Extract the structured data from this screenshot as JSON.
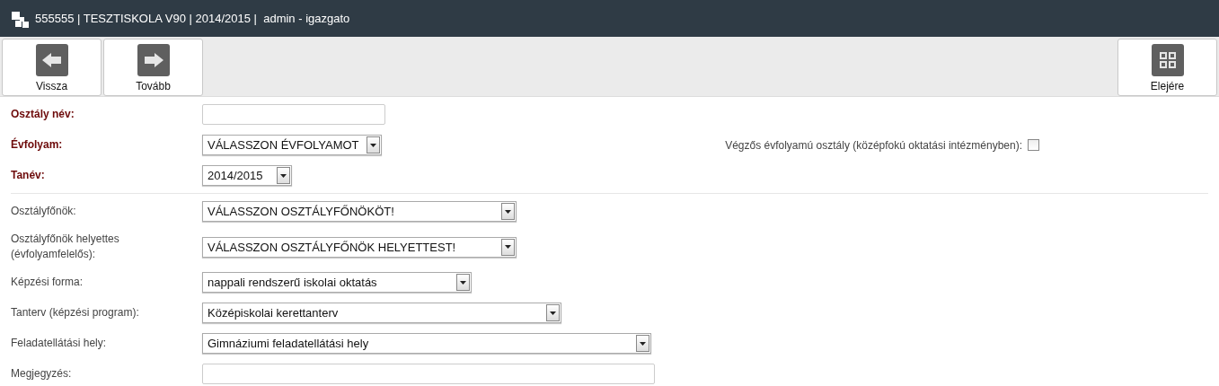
{
  "header": {
    "title": "555555 | TESZTISKOLA V90 | 2014/2015 |  admin - igazgato"
  },
  "toolbar": {
    "left": [
      {
        "kind": "back",
        "label": "Vissza"
      },
      {
        "kind": "forward",
        "label": "Tovább"
      }
    ],
    "right": [
      {
        "kind": "home",
        "label": "Elejére"
      }
    ]
  },
  "form": {
    "sections": [
      [
        {
          "label": "Osztály név:",
          "required": true,
          "kind": "text"
        },
        {
          "label": "Évfolyam:",
          "required": true,
          "kind": "select",
          "value": "VÁLASSZON ÉVFOLYAMOT",
          "extra": {
            "label": "Végzős évfolyamú osztály (középfokú oktatási intézményben):",
            "checked": false
          }
        },
        {
          "label": "Tanév:",
          "required": true,
          "kind": "select",
          "value": "2014/2015"
        }
      ],
      [
        {
          "label": "Osztályfőnök:",
          "required": false,
          "kind": "select",
          "value": "VÁLASSZON OSZTÁLYFŐNÖKÖT!"
        },
        {
          "label": "Osztályfőnök helyettes (évfolyamfelelős):",
          "required": false,
          "kind": "select",
          "value": "VÁLASSZON OSZTÁLYFŐNÖK HELYETTEST!"
        },
        {
          "label": "Képzési forma:",
          "required": false,
          "kind": "select",
          "value": "nappali rendszerű iskolai oktatás"
        },
        {
          "label": "Tanterv (képzési program):",
          "required": false,
          "kind": "select",
          "value": "Középiskolai kerettanterv"
        },
        {
          "label": "Feladatellátási hely:",
          "required": false,
          "kind": "select",
          "value": "Gimnáziumi feladatellátási hely"
        },
        {
          "label": "Megjegyzés:",
          "required": false,
          "kind": "text"
        }
      ]
    ]
  }
}
